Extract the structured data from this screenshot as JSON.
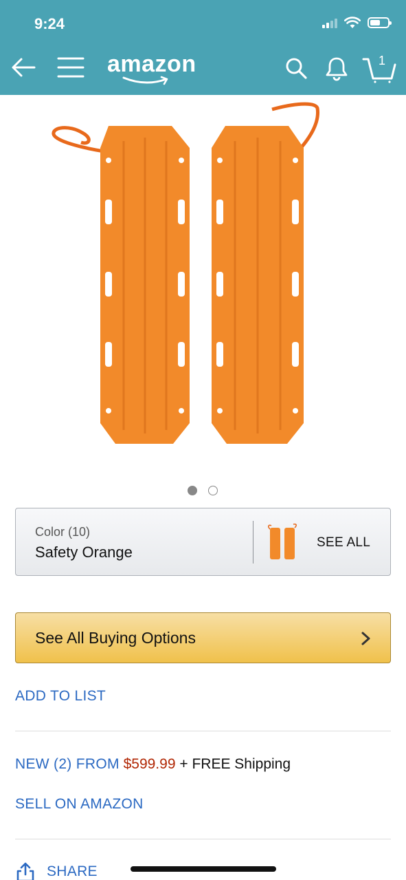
{
  "status_bar": {
    "time": "9:24"
  },
  "header": {
    "logo_text": "amazon",
    "cart_count": "1",
    "background_color": "#4aa3b4"
  },
  "product": {
    "image_icon": "orange-traction-boards-image",
    "carousel": {
      "count": 2,
      "active_index": 0
    }
  },
  "color_selector": {
    "label": "Color (10)",
    "value": "Safety Orange",
    "see_all": "SEE ALL"
  },
  "buying_options": {
    "label": "See All Buying Options"
  },
  "add_to_list": "ADD TO LIST",
  "offer": {
    "prefix": "NEW (2) FROM",
    "price": "$599.99",
    "shipping": "+ FREE Shipping",
    "price_color": "#b12704"
  },
  "sell": "SELL ON AMAZON",
  "share": "SHARE",
  "colors": {
    "link": "#2b69c2",
    "button_yellow": "#f0c14b"
  }
}
